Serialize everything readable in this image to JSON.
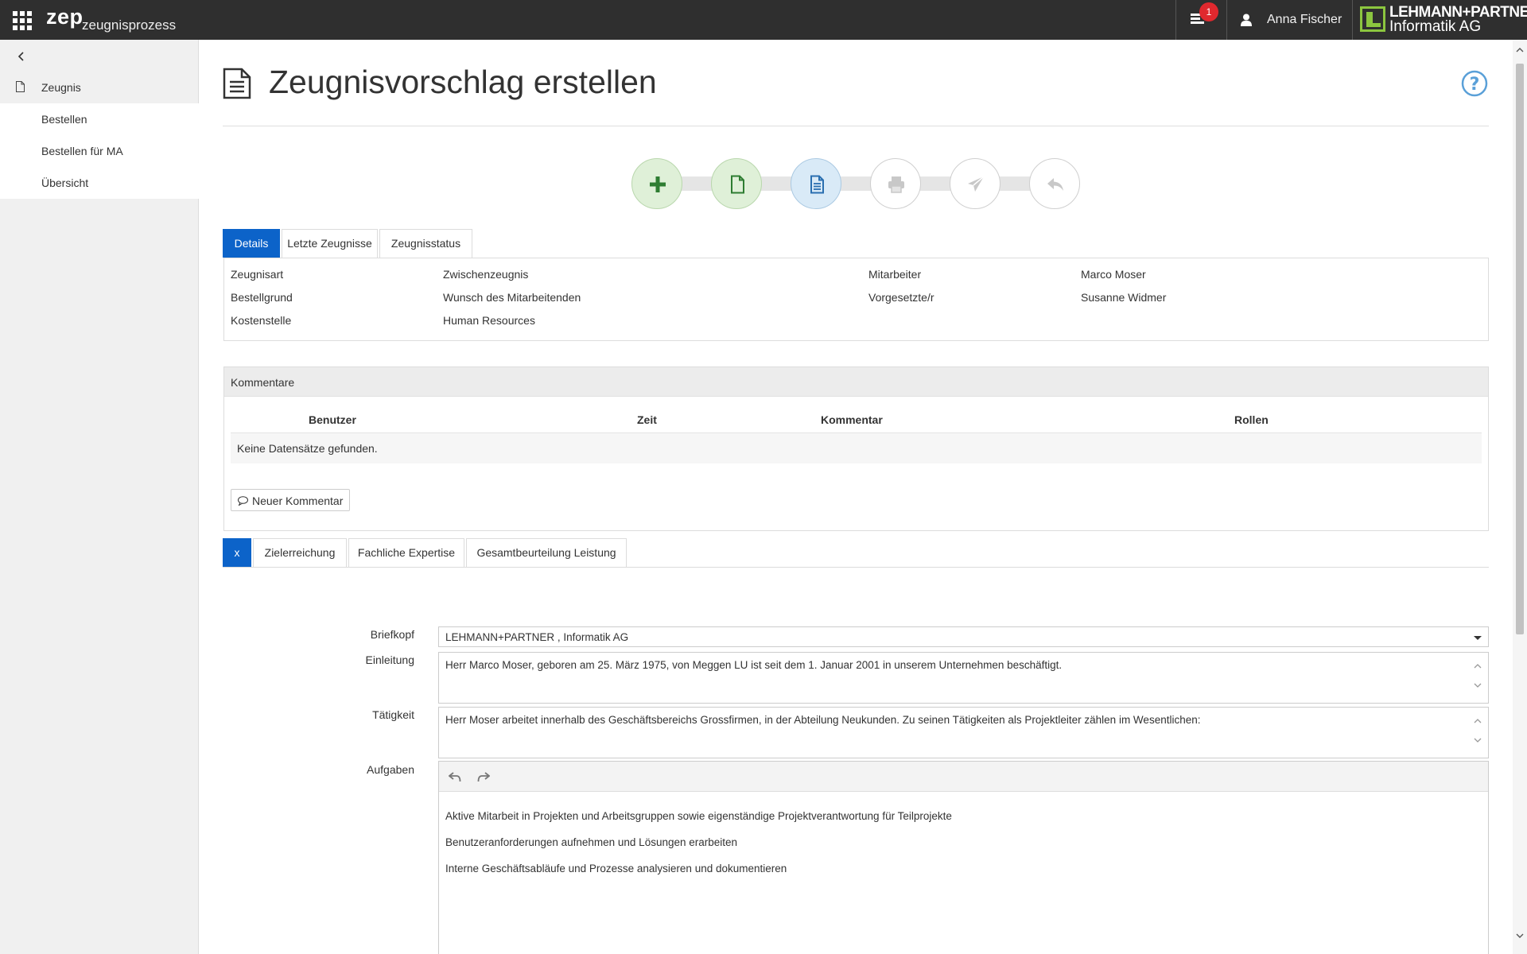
{
  "app": {
    "brand": "zep",
    "brand_sub": "zeugnisprozess",
    "notification_count": "1",
    "user_name": "Anna Fischer",
    "company_line1": "LEHMANN+PARTNER",
    "company_line2": "Informatik AG",
    "accent_color": "#0c63c9",
    "badge_color": "#e0282e",
    "logo_color": "#8cc63f"
  },
  "sidebar": {
    "section_label": "Zeugnis",
    "items": [
      {
        "label": "Bestellen"
      },
      {
        "label": "Bestellen für MA"
      },
      {
        "label": "Übersicht"
      }
    ]
  },
  "page": {
    "title": "Zeugnisvorschlag erstellen"
  },
  "stepper": {
    "steps": [
      {
        "icon": "plus-icon",
        "state": "done"
      },
      {
        "icon": "document-icon",
        "state": "done"
      },
      {
        "icon": "document-text-icon",
        "state": "active"
      },
      {
        "icon": "print-icon",
        "state": "pending"
      },
      {
        "icon": "send-icon",
        "state": "pending"
      },
      {
        "icon": "reply-icon",
        "state": "pending"
      }
    ]
  },
  "tabs_top": [
    {
      "label": "Details",
      "active": true
    },
    {
      "label": "Letzte Zeugnisse",
      "active": false
    },
    {
      "label": "Zeugnisstatus",
      "active": false
    }
  ],
  "details": {
    "zeugnisart_label": "Zeugnisart",
    "zeugnisart_value": "Zwischenzeugnis",
    "bestellgrund_label": "Bestellgrund",
    "bestellgrund_value": "Wunsch des Mitarbeitenden",
    "kostenstelle_label": "Kostenstelle",
    "kostenstelle_value": "Human Resources",
    "mitarbeiter_label": "Mitarbeiter",
    "mitarbeiter_value": "Marco Moser",
    "vorgesetzte_label": "Vorgesetzte/r",
    "vorgesetzte_value": "Susanne Widmer"
  },
  "comments": {
    "title": "Kommentare",
    "columns": [
      "Benutzer",
      "Zeit",
      "Kommentar",
      "Rollen"
    ],
    "empty_text": "Keine Datensätze gefunden.",
    "new_button": "Neuer Kommentar"
  },
  "tabs_form": [
    {
      "label": "x",
      "active": true
    },
    {
      "label": "Zielerreichung",
      "active": false
    },
    {
      "label": "Fachliche Expertise",
      "active": false
    },
    {
      "label": "Gesamtbeurteilung Leistung",
      "active": false
    }
  ],
  "form": {
    "briefkopf_label": "Briefkopf",
    "briefkopf_value": "LEHMANN+PARTNER , Informatik AG",
    "einleitung_label": "Einleitung",
    "einleitung_value": "Herr Marco Moser, geboren am 25. März 1975, von Meggen LU ist seit dem 1. Januar 2001 in unserem Unternehmen beschäftigt.",
    "taetigkeit_label": "Tätigkeit",
    "taetigkeit_value": "Herr Moser arbeitet innerhalb des Geschäftsbereichs Grossfirmen, in der Abteilung Neukunden. Zu seinen Tätigkeiten als Projektleiter zählen im Wesentlichen:",
    "aufgaben_label": "Aufgaben",
    "aufgaben_lines": [
      "Aktive Mitarbeit in Projekten und Arbeitsgruppen sowie eigenständige Projektverantwortung für Teilprojekte",
      "Benutzeranforderungen aufnehmen und Lösungen erarbeiten",
      "Interne Geschäftsabläufe und Prozesse analysieren und dokumentieren"
    ]
  }
}
